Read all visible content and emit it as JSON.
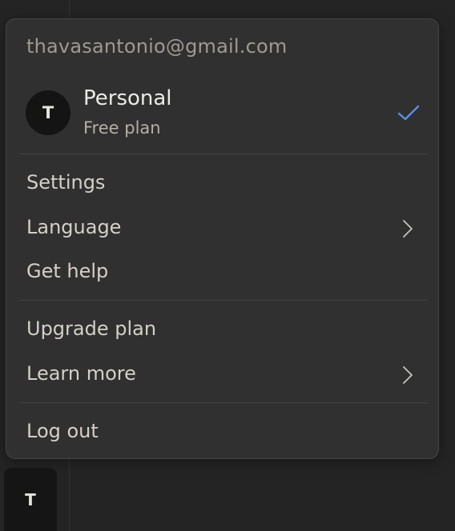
{
  "account": {
    "email": "thavasantonio@gmail.com",
    "avatar_initial": "T",
    "name": "Personal",
    "plan": "Free plan",
    "selected_icon": "check-icon"
  },
  "menu": {
    "settings": "Settings",
    "language": "Language",
    "get_help": "Get help",
    "upgrade_plan": "Upgrade plan",
    "learn_more": "Learn more",
    "log_out": "Log out"
  },
  "bottom_avatar": {
    "initial": "T"
  },
  "colors": {
    "background": "#242424",
    "menu_background": "#303030",
    "check_accent": "#5b8ee6"
  }
}
